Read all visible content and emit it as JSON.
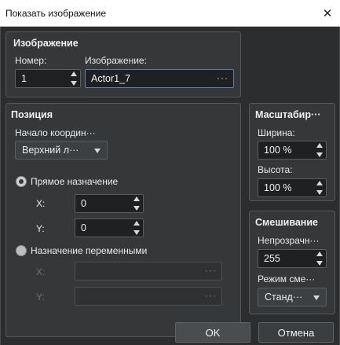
{
  "window": {
    "title": "Показать изображение"
  },
  "image_group": {
    "title": "Изображение",
    "number_label": "Номер:",
    "number_value": "1",
    "image_label": "Изображение:",
    "image_value": "Actor1_7",
    "picker_dots": "···"
  },
  "position_group": {
    "title": "Позиция",
    "origin_label": "Начало координ···",
    "origin_value": "Верхний л···",
    "direct": {
      "label": "Прямое назначение",
      "selected": true,
      "x_label": "X:",
      "x_value": "0",
      "y_label": "Y:",
      "y_value": "0"
    },
    "variables": {
      "label": "Назначение переменными",
      "selected": false,
      "x_label": "X:",
      "y_label": "Y:",
      "dots": "···"
    }
  },
  "scale_group": {
    "title": "Масштабир···",
    "width_label": "Ширина:",
    "width_value": "100 %",
    "height_label": "Высота:",
    "height_value": "100 %"
  },
  "blend_group": {
    "title": "Смешивание",
    "opacity_label": "Непрозрачн···",
    "opacity_value": "255",
    "mode_label": "Режим сме···",
    "mode_value": "Станд···"
  },
  "buttons": {
    "ok": "OK",
    "cancel": "Отмена"
  }
}
